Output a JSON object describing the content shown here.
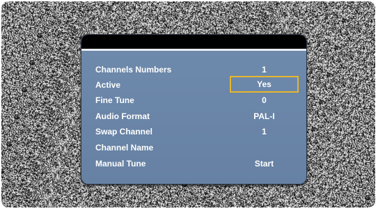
{
  "menu": {
    "rows": [
      {
        "label": "Channels Numbers",
        "value": "1"
      },
      {
        "label": "Active",
        "value": "Yes",
        "selected": true
      },
      {
        "label": "Fine Tune",
        "value": "0"
      },
      {
        "label": "Audio Format",
        "value": "PAL-I"
      },
      {
        "label": "Swap Channel",
        "value": "1"
      },
      {
        "label": "Channel Name",
        "value": ""
      },
      {
        "label": "Manual Tune",
        "value": "Start"
      }
    ]
  },
  "colors": {
    "panel": "#6b86a8",
    "header": "#000000",
    "selection_border": "#e6b72e",
    "text": "#ffffff"
  }
}
